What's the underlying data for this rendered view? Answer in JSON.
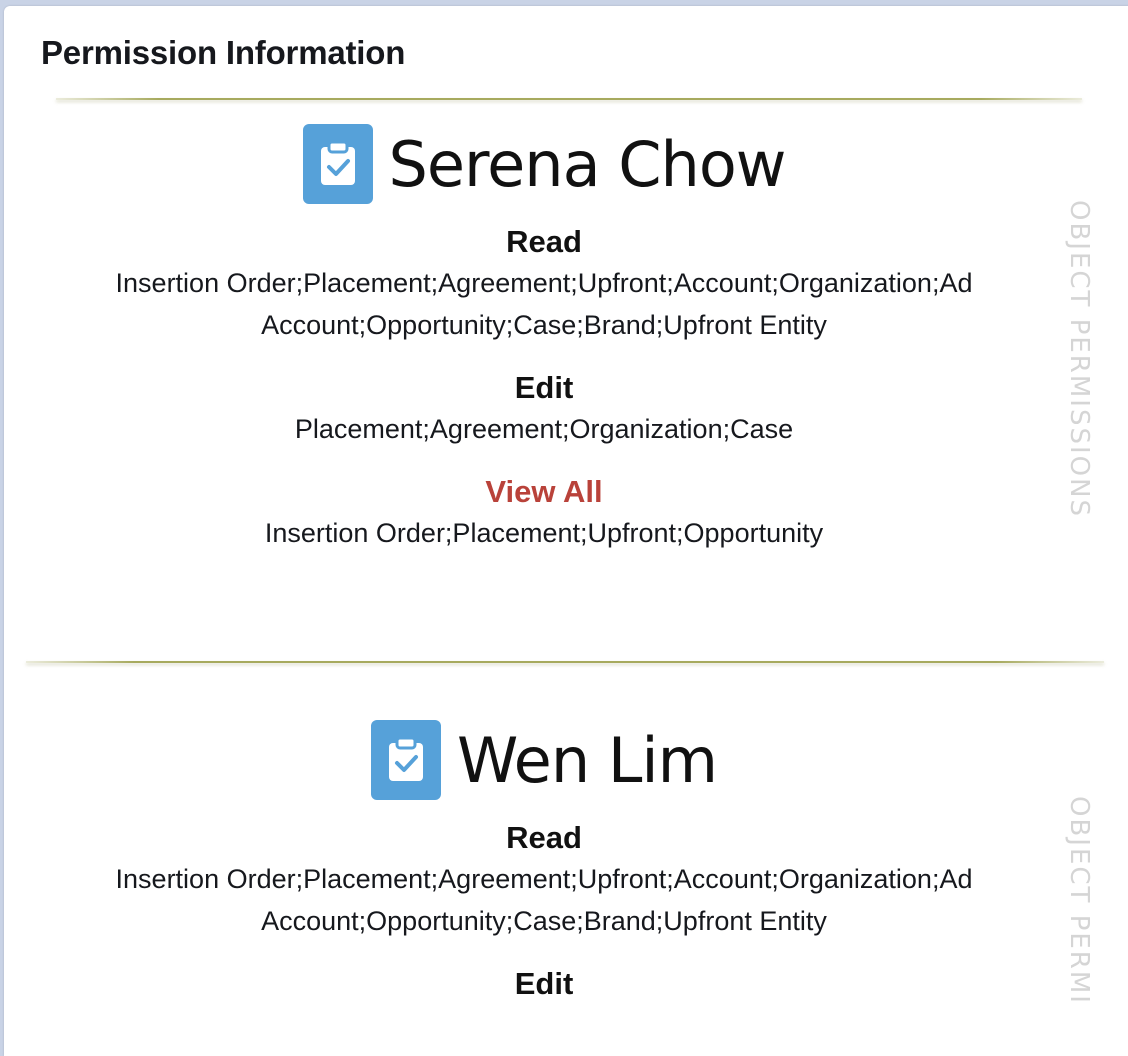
{
  "panel": {
    "title": "Permission Information"
  },
  "cards": [
    {
      "name": "Serena Chow",
      "side_label": "OBJECT PERMISSIONS",
      "sections": [
        {
          "title": "Read",
          "text": "Insertion Order;Placement;Agreement;Upfront;Account;Organization;Ad Account;Opportunity;Case;Brand;Upfront Entity"
        },
        {
          "title": "Edit",
          "text": "Placement;Agreement;Organization;Case"
        },
        {
          "title": "View All",
          "text": "Insertion Order;Placement;Upfront;Opportunity"
        }
      ]
    },
    {
      "name": "Wen Lim",
      "side_label": "OBJECT PERMI",
      "sections": [
        {
          "title": "Read",
          "text": "Insertion Order;Placement;Agreement;Upfront;Account;Organization;Ad Account;Opportunity;Case;Brand;Upfront Entity"
        },
        {
          "title": "Edit",
          "text": ""
        }
      ]
    }
  ],
  "colors": {
    "accent": "#b9423a",
    "icon_bg": "#56a1d9",
    "divider": "#a7aa5e"
  },
  "icons": {
    "card_icon": "clipboard-check-icon"
  }
}
